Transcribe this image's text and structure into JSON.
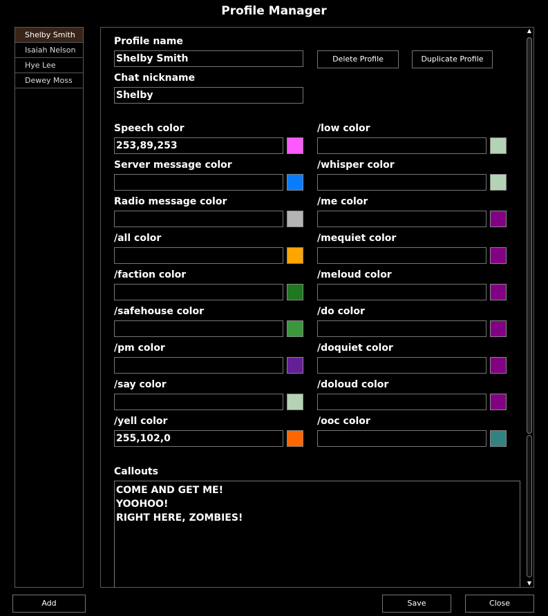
{
  "window": {
    "title": "Profile Manager"
  },
  "profiles": [
    {
      "name": "Shelby Smith",
      "selected": true
    },
    {
      "name": "Isaiah Nelson",
      "selected": false
    },
    {
      "name": "Hye Lee",
      "selected": false
    },
    {
      "name": "Dewey Moss",
      "selected": false
    }
  ],
  "profile": {
    "name_label": "Profile name",
    "name_value": "Shelby Smith",
    "nickname_label": "Chat nickname",
    "nickname_value": "Shelby",
    "delete_label": "Delete Profile",
    "duplicate_label": "Duplicate Profile"
  },
  "colors_left": [
    {
      "label": "Speech color",
      "value": "253,89,253",
      "swatch": "#fd59fd"
    },
    {
      "label": "Server message color",
      "value": "",
      "swatch": "#0a7dff"
    },
    {
      "label": "Radio message color",
      "value": "",
      "swatch": "#b4b4b4"
    },
    {
      "label": "/all color",
      "value": "",
      "swatch": "#ffa500"
    },
    {
      "label": "/faction color",
      "value": "",
      "swatch": "#1e781e"
    },
    {
      "label": "/safehouse color",
      "value": "",
      "swatch": "#3c963c"
    },
    {
      "label": "/pm color",
      "value": "",
      "swatch": "#641e96"
    },
    {
      "label": "/say color",
      "value": "",
      "swatch": "#b4d2b4"
    },
    {
      "label": "/yell color",
      "value": "255,102,0",
      "swatch": "#ff6600"
    }
  ],
  "colors_right": [
    {
      "label": "/low color",
      "value": "",
      "swatch": "#b4d2b4"
    },
    {
      "label": "/whisper color",
      "value": "",
      "swatch": "#b4d2b4"
    },
    {
      "label": "/me color",
      "value": "",
      "swatch": "#820082"
    },
    {
      "label": "/mequiet color",
      "value": "",
      "swatch": "#820082"
    },
    {
      "label": "/meloud color",
      "value": "",
      "swatch": "#820082"
    },
    {
      "label": "/do color",
      "value": "",
      "swatch": "#820082"
    },
    {
      "label": "/doquiet color",
      "value": "",
      "swatch": "#820082"
    },
    {
      "label": "/doloud color",
      "value": "",
      "swatch": "#820082"
    },
    {
      "label": "/ooc color",
      "value": "",
      "swatch": "#328282"
    }
  ],
  "callouts": {
    "label": "Callouts",
    "lines": [
      "COME AND GET ME!",
      "YOOHOO!",
      "RIGHT HERE, ZOMBIES!"
    ]
  },
  "buttons": {
    "add": "Add",
    "save": "Save",
    "close": "Close"
  },
  "scrollbar": {
    "up_icon": "▲",
    "down_icon": "▼"
  }
}
